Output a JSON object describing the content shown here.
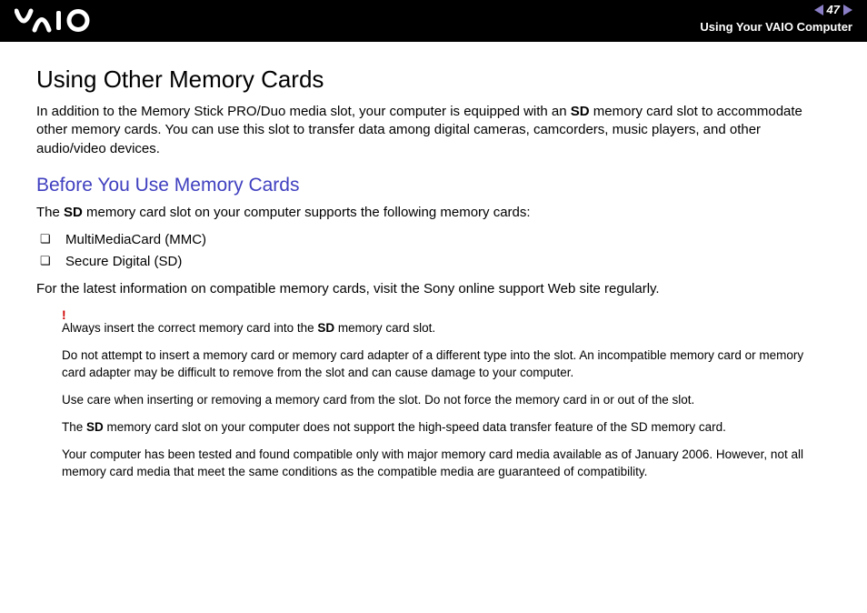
{
  "header": {
    "logo_text": "VAIO",
    "page_number": "47",
    "breadcrumb": "Using Your VAIO Computer"
  },
  "content": {
    "title": "Using Other Memory Cards",
    "intro_pre": "In addition to the Memory Stick PRO/Duo media slot, your computer is equipped with an ",
    "intro_bold": "SD",
    "intro_post": " memory card slot to accommodate other memory cards. You can use this slot to transfer data among digital cameras, camcorders, music players, and other audio/video devices.",
    "subtitle": "Before You Use Memory Cards",
    "sub_intro_pre": "The ",
    "sub_intro_bold": "SD",
    "sub_intro_post": " memory card slot on your computer supports the following memory cards:",
    "bullets": [
      "MultiMediaCard (MMC)",
      "Secure Digital (SD)"
    ],
    "after_bullets": "For the latest information on compatible memory cards, visit the Sony online support Web site regularly.",
    "warn_mark": "!",
    "warnings": {
      "w1_pre": "Always insert the correct memory card into the ",
      "w1_bold": "SD",
      "w1_post": " memory card slot.",
      "w2": "Do not attempt to insert a memory card or memory card adapter of a different type into the slot. An incompatible memory card or memory card adapter may be difficult to remove from the slot and can cause damage to your computer.",
      "w3": "Use care when inserting or removing a memory card from the slot. Do not force the memory card in or out of the slot.",
      "w4_pre": "The ",
      "w4_bold": "SD",
      "w4_post": " memory card slot on your computer does not support the high-speed data transfer feature of the SD memory card.",
      "w5": "Your computer has been tested and found compatible only with major memory card media available as of January 2006. However, not all memory card media that meet the same conditions as the compatible media are guaranteed of compatibility."
    }
  }
}
